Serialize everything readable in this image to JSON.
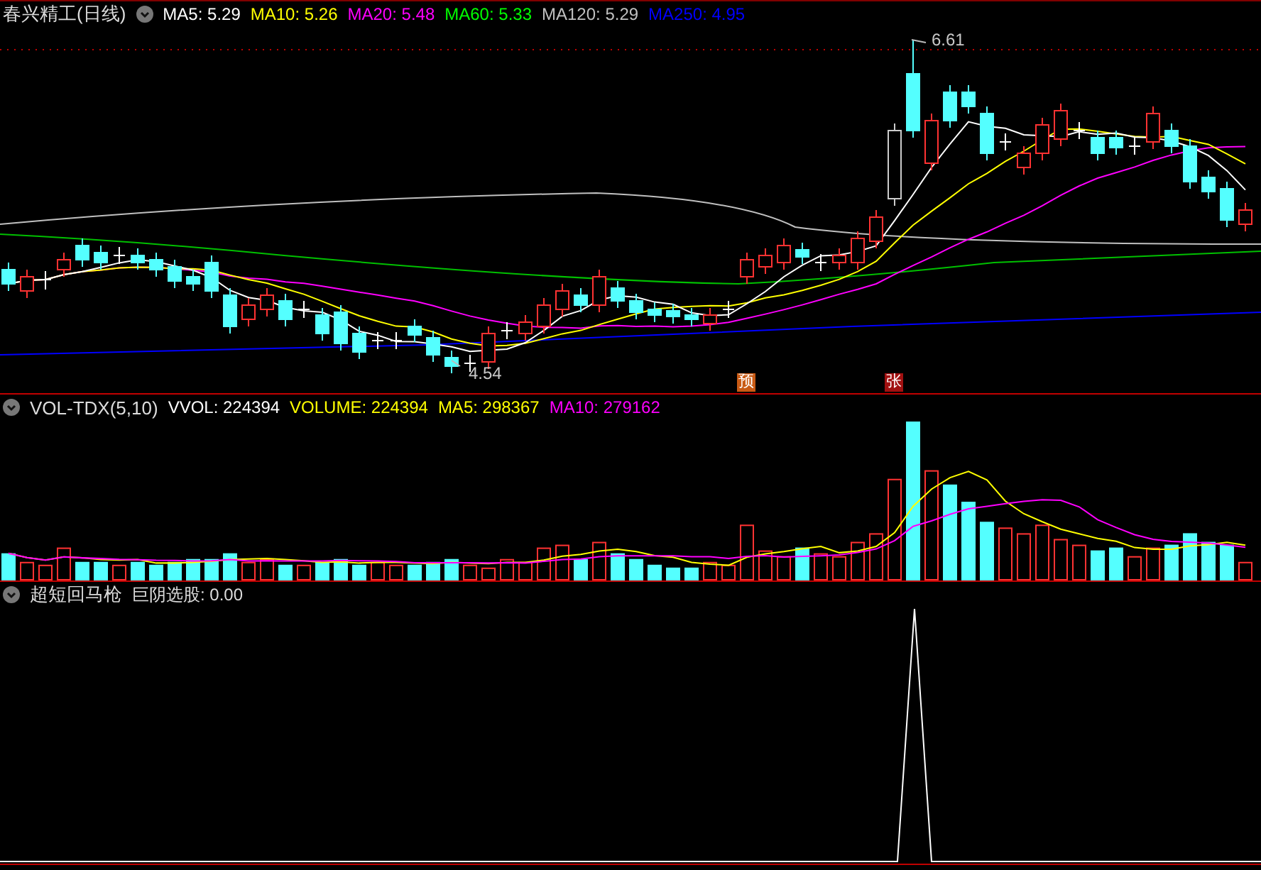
{
  "price_panel": {
    "title": "春兴精工(日线)",
    "indicators": [
      {
        "label": "MA5: 5.29",
        "color": "#ffffff"
      },
      {
        "label": "MA10: 5.26",
        "color": "#ffff00"
      },
      {
        "label": "MA20: 5.48",
        "color": "#ff00ff"
      },
      {
        "label": "MA60: 5.33",
        "color": "#00ff00"
      },
      {
        "label": "MA120: 5.29",
        "color": "#c0c0c0"
      },
      {
        "label": "MA250: 4.95",
        "color": "#0000ff"
      }
    ],
    "high_label": "6.61",
    "low_label": "4.54",
    "markers": [
      {
        "text": "预",
        "color": "#c85a14"
      },
      {
        "text": "张",
        "color": "#a01010"
      }
    ]
  },
  "volume_panel": {
    "title": "VOL-TDX(5,10)",
    "indicators": [
      {
        "label": "VVOL: 224394",
        "color": "#ffffff"
      },
      {
        "label": "VOLUME: 224394",
        "color": "#ffff00"
      },
      {
        "label": "MA5: 298367",
        "color": "#ffff00"
      },
      {
        "label": "MA10: 279162",
        "color": "#ff00ff"
      }
    ]
  },
  "signal_panel": {
    "title": "超短回马枪",
    "indicators": [
      {
        "label": "巨阴选股: 0.00",
        "color": "#dcdcdc"
      }
    ]
  }
}
